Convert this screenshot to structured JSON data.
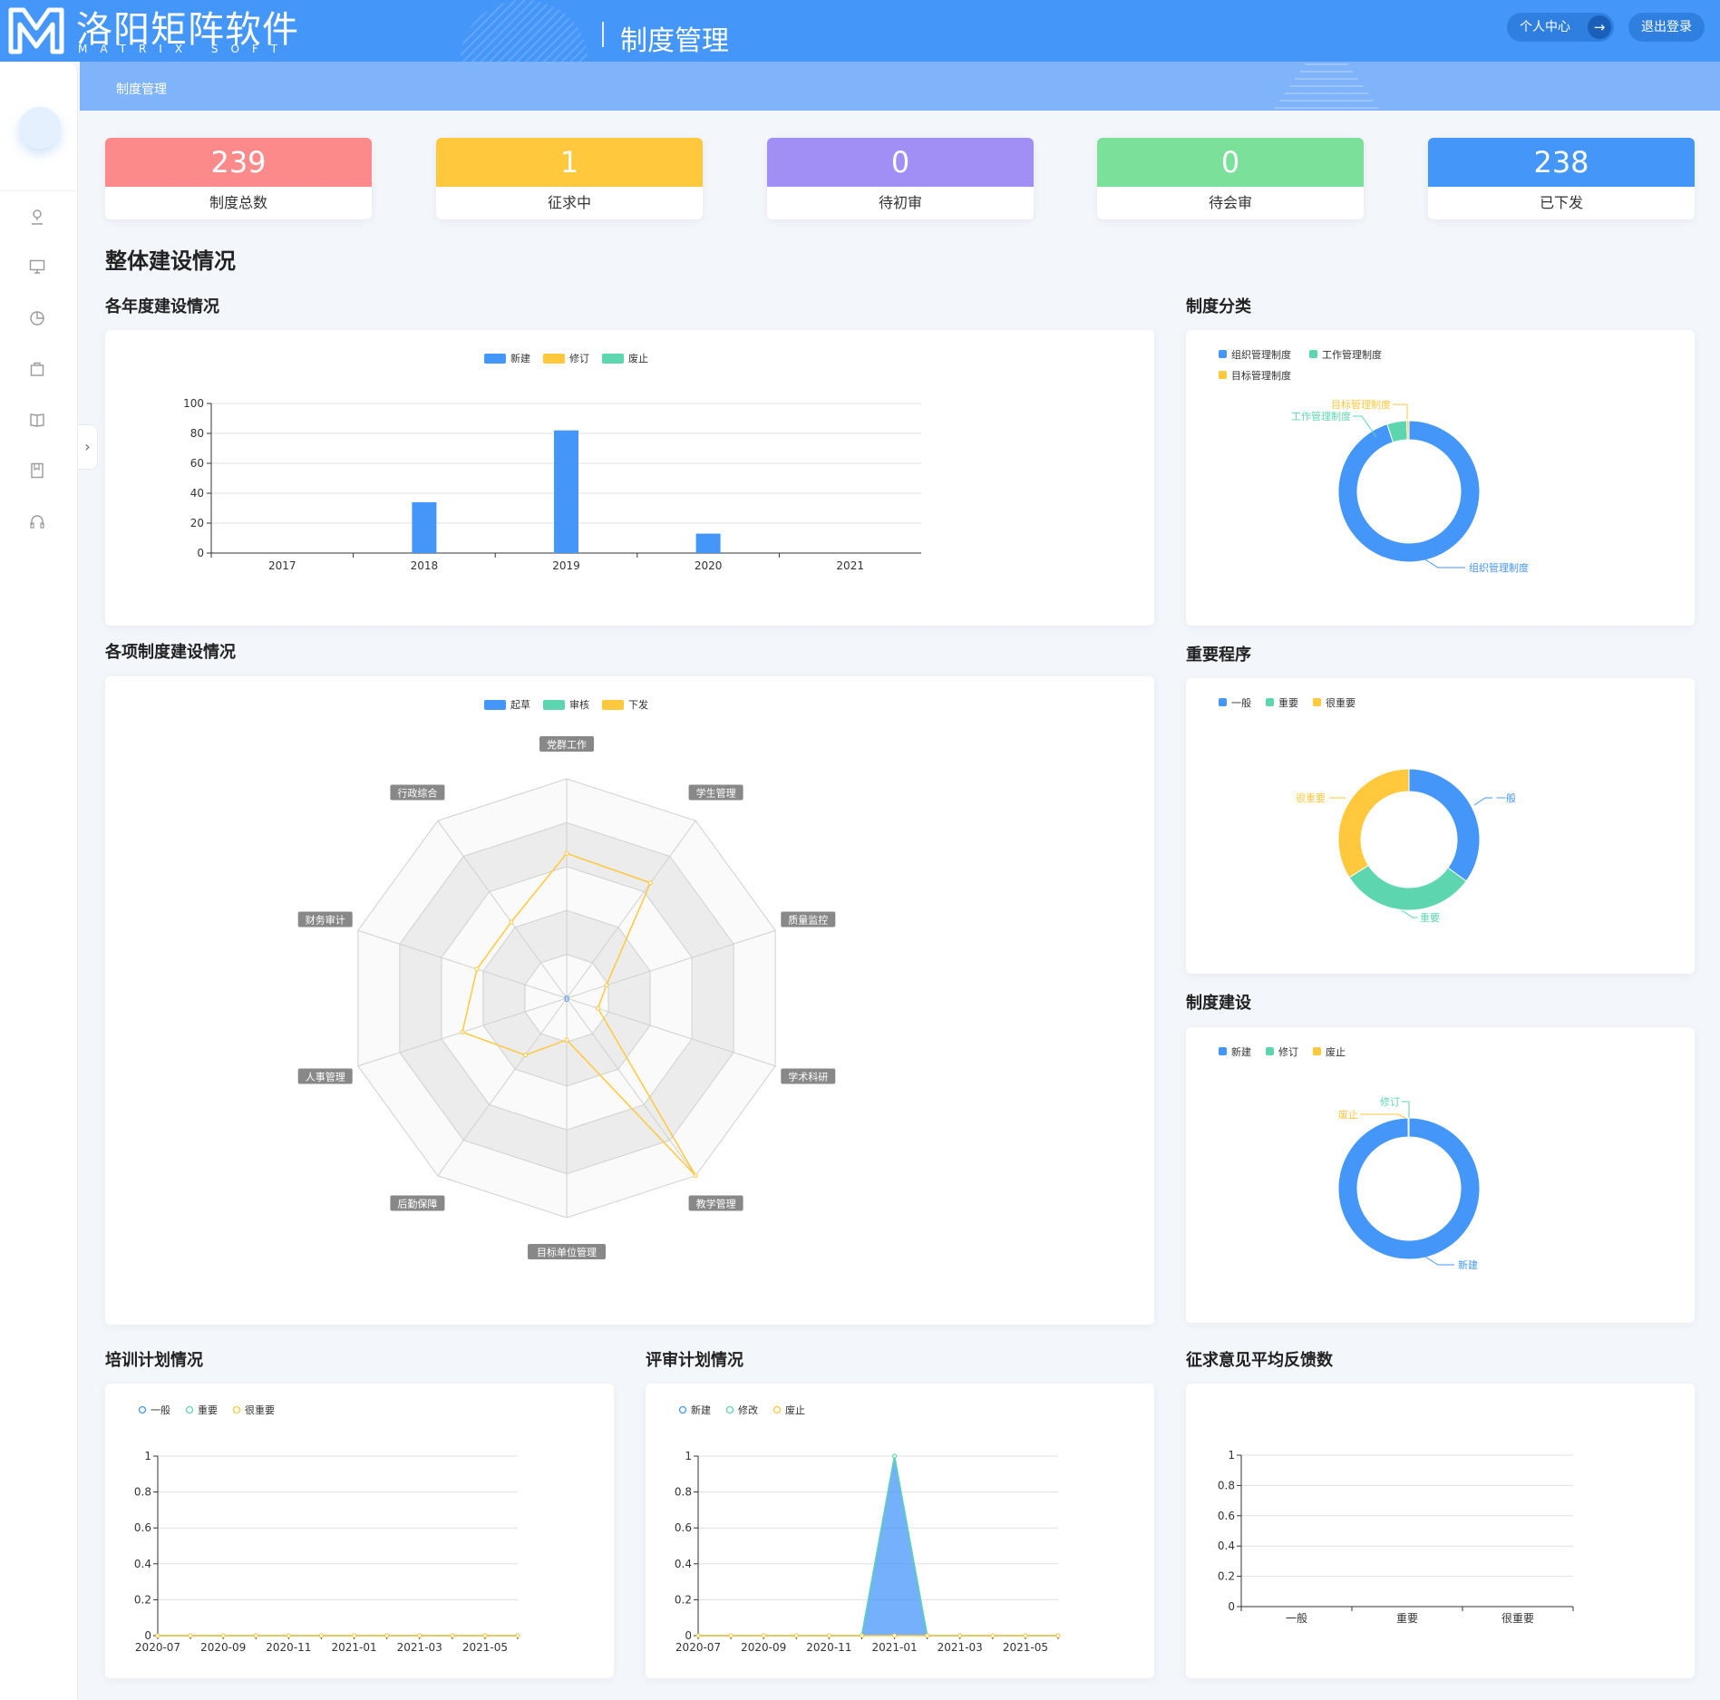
{
  "header": {
    "logo_cn": "洛阳矩阵软件",
    "logo_en": "MATRIX SOFT",
    "title": "制度管理",
    "user_center": "个人中心",
    "logout": "退出登录"
  },
  "breadcrumb": "制度管理",
  "sidebar": {
    "icons": [
      "user-icon",
      "monitor-icon",
      "pie-icon",
      "bag-icon",
      "book-icon",
      "notebook-icon",
      "headset-icon"
    ]
  },
  "stats": [
    {
      "value": "239",
      "label": "制度总数",
      "color": "#fd8a8a"
    },
    {
      "value": "1",
      "label": "征求中",
      "color": "#ffc83d"
    },
    {
      "value": "0",
      "label": "待初审",
      "color": "#a28ff5"
    },
    {
      "value": "0",
      "label": "待会审",
      "color": "#7be09a"
    },
    {
      "value": "238",
      "label": "已下发",
      "color": "#4596f9"
    }
  ],
  "section_main": "整体建设情况",
  "sections": {
    "annual": "各年度建设情况",
    "category": "制度分类",
    "items": "各项制度建设情况",
    "importance": "重要程序",
    "build": "制度建设",
    "training": "培训计划情况",
    "review": "评审计划情况",
    "feedback": "征求意见平均反馈数"
  },
  "colors": {
    "blue": "#4596f9",
    "yellow": "#ffc83d",
    "green": "#5dd6b0"
  },
  "chart_data": [
    {
      "id": "annual",
      "type": "bar",
      "categories": [
        "2017",
        "2018",
        "2019",
        "2020",
        "2021"
      ],
      "series": [
        {
          "name": "新建",
          "values": [
            0,
            34,
            82,
            13,
            0
          ]
        },
        {
          "name": "修订",
          "values": [
            0,
            0,
            0,
            0,
            0
          ]
        },
        {
          "name": "废止",
          "values": [
            0,
            0,
            0,
            0,
            0
          ]
        }
      ],
      "yticks": [
        0,
        20,
        40,
        60,
        80,
        100
      ],
      "ylim": [
        0,
        100
      ]
    },
    {
      "id": "category",
      "type": "pie",
      "legend": [
        "组织管理制度",
        "工作管理制度",
        "目标管理制度"
      ],
      "slices": [
        {
          "name": "组织管理制度",
          "value": 95
        },
        {
          "name": "工作管理制度",
          "value": 4.5
        },
        {
          "name": "目标管理制度",
          "value": 0.5
        }
      ]
    },
    {
      "id": "items",
      "type": "radar",
      "legend": [
        "起草",
        "审核",
        "下发"
      ],
      "indicators": [
        "党群工作",
        "学生管理",
        "质量监控",
        "学术科研",
        "教学管理",
        "目标单位管理",
        "后勤保障",
        "人事管理",
        "财务审计",
        "行政综合"
      ],
      "series": [
        {
          "name": "下发",
          "values": [
            0.66,
            0.65,
            0.19,
            0.15,
            1.0,
            0.19,
            0.32,
            0.5,
            0.43,
            0.43
          ]
        }
      ],
      "center_label": "0"
    },
    {
      "id": "importance",
      "type": "pie",
      "legend": [
        "一般",
        "重要",
        "很重要"
      ],
      "slices": [
        {
          "name": "一般",
          "value": 35
        },
        {
          "name": "重要",
          "value": 31
        },
        {
          "name": "很重要",
          "value": 34
        }
      ]
    },
    {
      "id": "build",
      "type": "pie",
      "legend": [
        "新建",
        "修订",
        "废止"
      ],
      "slices": [
        {
          "name": "新建",
          "value": 99.8
        },
        {
          "name": "修订",
          "value": 0.1
        },
        {
          "name": "废止",
          "value": 0.1
        }
      ]
    },
    {
      "id": "training",
      "type": "line",
      "legend": [
        "一般",
        "重要",
        "很重要"
      ],
      "x": [
        "2020-07",
        "2020-08",
        "2020-09",
        "2020-10",
        "2020-11",
        "2020-12",
        "2021-01",
        "2021-02",
        "2021-03",
        "2021-04",
        "2021-05",
        "2021-06"
      ],
      "xlabels": [
        "2020-07",
        "2020-09",
        "2020-11",
        "2021-01",
        "2021-03",
        "2021-05"
      ],
      "series": [
        {
          "name": "一般",
          "values": [
            0,
            0,
            0,
            0,
            0,
            0,
            0,
            0,
            0,
            0,
            0,
            0
          ]
        },
        {
          "name": "重要",
          "values": [
            0,
            0,
            0,
            0,
            0,
            0,
            0,
            0,
            0,
            0,
            0,
            0
          ]
        },
        {
          "name": "很重要",
          "values": [
            0,
            0,
            0,
            0,
            0,
            0,
            0,
            0,
            0,
            0,
            0,
            0
          ]
        }
      ],
      "yticks": [
        "0",
        "0.2",
        "0.4",
        "0.6",
        "0.8",
        "1"
      ],
      "ylim": [
        0,
        1
      ]
    },
    {
      "id": "review",
      "type": "area",
      "legend": [
        "新建",
        "修改",
        "废止"
      ],
      "x": [
        "2020-07",
        "2020-08",
        "2020-09",
        "2020-10",
        "2020-11",
        "2020-12",
        "2021-01",
        "2021-02",
        "2021-03",
        "2021-04",
        "2021-05",
        "2021-06"
      ],
      "xlabels": [
        "2020-07",
        "2020-09",
        "2020-11",
        "2021-01",
        "2021-03",
        "2021-05"
      ],
      "series": [
        {
          "name": "新建",
          "values": [
            0,
            0,
            0,
            0,
            0,
            0,
            1,
            0,
            0,
            0,
            0,
            0
          ]
        },
        {
          "name": "修改",
          "values": [
            0,
            0,
            0,
            0,
            0,
            0,
            1,
            0,
            0,
            0,
            0,
            0
          ]
        },
        {
          "name": "废止",
          "values": [
            0,
            0,
            0,
            0,
            0,
            0,
            0,
            0,
            0,
            0,
            0,
            0
          ]
        }
      ],
      "yticks": [
        "0",
        "0.2",
        "0.4",
        "0.6",
        "0.8",
        "1"
      ],
      "ylim": [
        0,
        1
      ]
    },
    {
      "id": "feedback",
      "type": "bar",
      "categories": [
        "一般",
        "重要",
        "很重要"
      ],
      "values": [
        0,
        0,
        0
      ],
      "yticks": [
        "0",
        "0.2",
        "0.4",
        "0.6",
        "0.8",
        "1"
      ],
      "ylim": [
        0,
        1
      ]
    }
  ]
}
